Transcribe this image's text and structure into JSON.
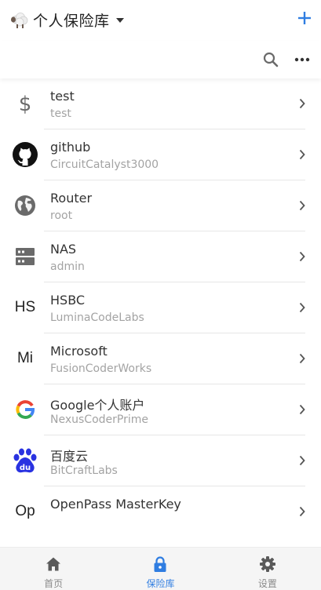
{
  "header": {
    "vault_name": "个人保险库",
    "add_icon": "plus-icon",
    "search_icon": "search-icon",
    "more_icon": "more-horizontal-icon"
  },
  "colors": {
    "accent": "#2f7de1",
    "icon_gray": "#6a6a6a",
    "divider": "#e6e6e6",
    "tabbar_bg": "#f5f5f5"
  },
  "items": [
    {
      "title": "test",
      "subtitle": "test",
      "icon": "dollar-icon"
    },
    {
      "title": "github",
      "subtitle": "CircuitCatalyst3000",
      "icon": "github-icon"
    },
    {
      "title": "Router",
      "subtitle": "root",
      "icon": "globe-icon"
    },
    {
      "title": "NAS",
      "subtitle": "admin",
      "icon": "server-icon"
    },
    {
      "title": "HSBC",
      "subtitle": "LuminaCodeLabs",
      "icon": "abbr-icon",
      "abbr": "HS"
    },
    {
      "title": "Microsoft",
      "subtitle": "FusionCoderWorks",
      "icon": "abbr-icon",
      "abbr": "Mi"
    },
    {
      "title": "Google个人账户",
      "subtitle": "NexusCoderPrime",
      "icon": "google-icon"
    },
    {
      "title": "百度云",
      "subtitle": "BitCraftLabs",
      "icon": "baidu-icon"
    },
    {
      "title": "OpenPass MasterKey",
      "subtitle": "",
      "icon": "abbr-icon",
      "abbr": "Op"
    }
  ],
  "tabs": [
    {
      "label": "首页",
      "icon": "home-icon",
      "active": false
    },
    {
      "label": "保险库",
      "icon": "lock-icon",
      "active": true
    },
    {
      "label": "设置",
      "icon": "gear-icon",
      "active": false
    }
  ]
}
